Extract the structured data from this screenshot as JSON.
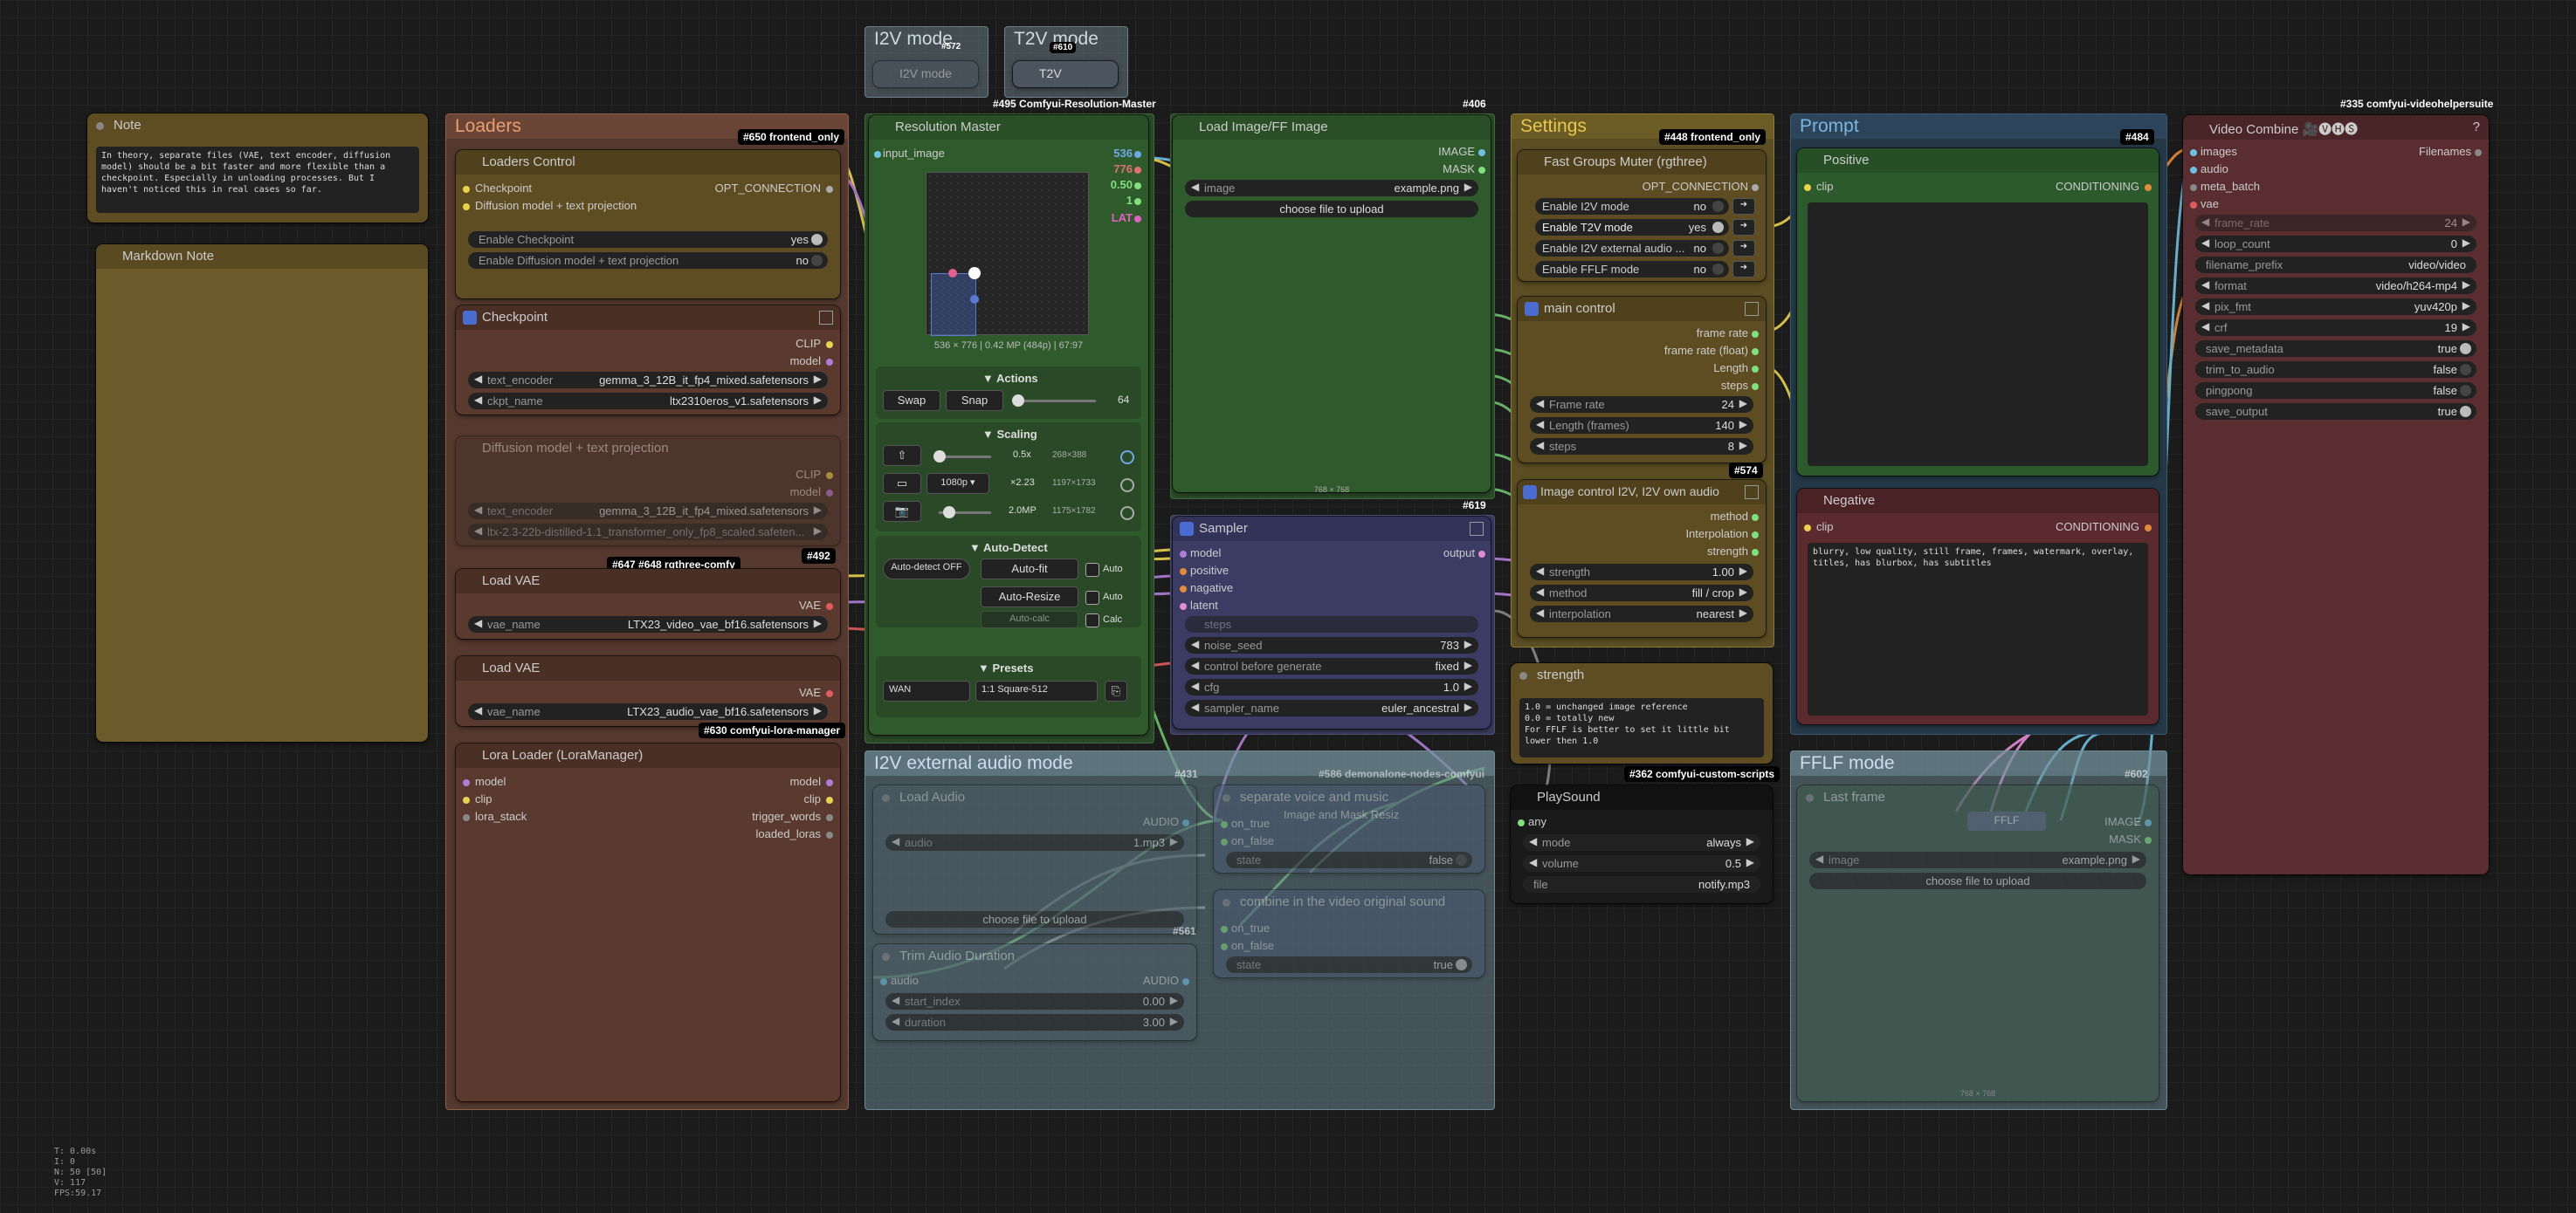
{
  "groups": {
    "i2v_mode_small": "I2V mode",
    "t2v_mode_small": "T2V mode",
    "loaders": "Loaders",
    "settings": "Settings",
    "prompt": "Prompt",
    "i2v_external_audio_mode": "I2V external audio mode",
    "fflf_mode": "FFLF mode"
  },
  "badges": {
    "b572": "#572",
    "b610": "#610",
    "b495": "#495 Comfyui-Resolution-Master",
    "b406": "#406",
    "b448": "#448 frontend_only",
    "b484": "#484",
    "b335": "#335 comfyui-videohelpersuite",
    "b650": "#650 frontend_only",
    "b492": "#492",
    "b647": "#647 #648 rgthree-comfy",
    "b630": "#630 comfyui-lora-manager",
    "b619": "#619",
    "b574": "#574",
    "b362": "#362 comfyui-custom-scripts",
    "b431": "#431",
    "b561": "#561",
    "b602": "#602",
    "b586": "#586 demonalone-nodes-comfyui"
  },
  "mini_nodes": {
    "i2v": "I2V mode",
    "t2v": "T2V"
  },
  "note": {
    "title": "Note",
    "text": "In theory, separate files (VAE, text encoder, diffusion model) should be a bit faster and more flexible than a checkpoint. Especially in unloading processes. But I haven't noticed this in real cases so far."
  },
  "markdown_note": {
    "title": "Markdown Note"
  },
  "loaders_control": {
    "title": "Loaders Control",
    "in1": "Checkpoint",
    "in2": "Diffusion model + text projection",
    "out": "OPT_CONNECTION",
    "w1_label": "Enable Checkpoint",
    "w1_value": "yes",
    "w2_label": "Enable Diffusion model + text projection",
    "w2_value": "no"
  },
  "checkpoint": {
    "title": "Checkpoint",
    "out1": "CLIP",
    "out2": "model",
    "text_encoder_label": "text_encoder",
    "text_encoder_value": "gemma_3_12B_it_fp4_mixed.safetensors",
    "ckpt_label": "ckpt_name",
    "ckpt_value": "ltx2310eros_v1.safetensors"
  },
  "diffusion_model": {
    "title": "Diffusion model + text projection",
    "out1": "CLIP",
    "out2": "model",
    "text_encoder_label": "text_encoder",
    "text_encoder_value": "gemma_3_12B_it_fp4_mixed.safetensors",
    "model_value": "ltx-2.3-22b-distilled-1.1_transformer_only_fp8_scaled.safeten..."
  },
  "load_vae_1": {
    "title": "Load VAE",
    "out": "VAE",
    "label": "vae_name",
    "value": "LTX23_video_vae_bf16.safetensors"
  },
  "load_vae_2": {
    "title": "Load VAE",
    "out": "VAE",
    "label": "vae_name",
    "value": "LTX23_audio_vae_bf16.safetensors"
  },
  "lora_loader": {
    "title": "Lora Loader (LoraManager)",
    "in1": "model",
    "in2": "clip",
    "in3": "lora_stack",
    "out1": "model",
    "out2": "clip",
    "out3": "trigger_words",
    "out4": "loaded_loras"
  },
  "resolution_master": {
    "title": "Resolution Master",
    "input": "input_image",
    "v1": "536",
    "v2": "776",
    "v3": "0.50",
    "v4": "1",
    "v5": "LAT",
    "info": "536 × 776  |  0.42 MP (484p)  |  67:97",
    "actions_h": "▼ Actions",
    "swap": "Swap",
    "snap": "Snap",
    "snap_val": "64",
    "scaling_h": "▼ Scaling",
    "s1_val": "0.5x",
    "s1_res": "268×388",
    "s2_sel": "1080p",
    "s2_val": "×2.23",
    "s2_res": "1197×1733",
    "s3_val": "2.0MP",
    "s3_res": "1175×1782",
    "autodetect_h": "▼ Auto-Detect",
    "autodetect_btn": "Auto-detect OFF",
    "autofit": "Auto-fit",
    "auto1": "Auto",
    "autoresize": "Auto-Resize",
    "auto2": "Auto",
    "autocalc": "Auto-calc",
    "calc": "Calc",
    "presets_h": "▼ Presets",
    "preset_cat": "WAN",
    "preset_val": "1:1 Square-512"
  },
  "load_image": {
    "title": "Load Image/FF Image",
    "out1": "IMAGE",
    "out2": "MASK",
    "img_label": "image",
    "img_value": "example.png",
    "upload": "choose file to upload",
    "dims": "768 × 768"
  },
  "sampler": {
    "title": "Sampler",
    "in1": "model",
    "in2": "positive",
    "in3": "nagative",
    "in4": "latent",
    "in5": "steps",
    "out": "output",
    "noise_label": "noise_seed",
    "noise_value": "783",
    "cbg_label": "control before generate",
    "cbg_value": "fixed",
    "cfg_label": "cfg",
    "cfg_value": "1.0",
    "sampler_label": "sampler_name",
    "sampler_value": "euler_ancestral"
  },
  "fast_groups": {
    "title": "Fast Groups Muter (rgthree)",
    "out": "OPT_CONNECTION",
    "r1": "Enable I2V mode",
    "r1v": "no",
    "r2": "Enable T2V mode",
    "r2v": "yes",
    "r3": "Enable I2V external audio ...",
    "r3v": "no",
    "r4": "Enable FFLF mode",
    "r4v": "no"
  },
  "main_control": {
    "title": "main control",
    "o1": "frame rate",
    "o2": "frame rate (float)",
    "o3": "Length",
    "o4": "steps",
    "w1": "Frame rate",
    "w1v": "24",
    "w2": "Length (frames)",
    "w2v": "140",
    "w3": "steps",
    "w3v": "8"
  },
  "image_control": {
    "title": "Image control I2V, I2V own audio",
    "o1": "method",
    "o2": "Interpolation",
    "o3": "strength",
    "w1": "strength",
    "w1v": "1.00",
    "w2": "method",
    "w2v": "fill / crop",
    "w3": "interpolation",
    "w3v": "nearest"
  },
  "strength_note": {
    "title": "strength",
    "text": "1.0 = unchanged image reference\n0.0 = totally new\nFor FFLF is better to set it little bit lower then 1.0"
  },
  "playsound": {
    "title": "PlaySound",
    "in": "any",
    "mode": "mode",
    "mode_v": "always",
    "volume": "volume",
    "volume_v": "0.5",
    "file": "file",
    "file_v": "notify.mp3"
  },
  "positive": {
    "title": "Positive",
    "in": "clip",
    "out": "CONDITIONING"
  },
  "negative": {
    "title": "Negative",
    "in": "clip",
    "out": "CONDITIONING",
    "text": "blurry, low quality, still frame, frames, watermark, overlay, titles, has blurbox, has subtitles"
  },
  "video_combine": {
    "title": "Video Combine 🎥🅥🅗🅢",
    "in1": "images",
    "in2": "audio",
    "in3": "meta_batch",
    "in4": "vae",
    "out": "Filenames",
    "rows": [
      {
        "l": "frame_rate",
        "v": "24"
      },
      {
        "l": "loop_count",
        "v": "0"
      },
      {
        "l": "filename_prefix",
        "v": "video/video"
      },
      {
        "l": "format",
        "v": "video/h264-mp4"
      },
      {
        "l": "pix_fmt",
        "v": "yuv420p"
      },
      {
        "l": "crf",
        "v": "19"
      },
      {
        "l": "save_metadata",
        "v": "true"
      },
      {
        "l": "trim_to_audio",
        "v": "false"
      },
      {
        "l": "pingpong",
        "v": "false"
      },
      {
        "l": "save_output",
        "v": "true"
      }
    ]
  },
  "load_audio": {
    "title": "Load Audio",
    "out": "AUDIO",
    "label": "audio",
    "value": "1.mp3",
    "upload": "choose file to upload"
  },
  "trim_audio": {
    "title": "Trim Audio Duration",
    "in": "audio",
    "out": "AUDIO",
    "w1": "start_index",
    "w1v": "0.00",
    "w2": "duration",
    "w2v": "3.00"
  },
  "separate_voice": {
    "title": "separate voice and music",
    "in1": "on_true",
    "in2": "on_false",
    "w": "state",
    "wv": "false",
    "sub": "Image and Mask Resiz"
  },
  "combine_video": {
    "title": "combine in the video original sound",
    "in1": "on_true",
    "in2": "on_false",
    "w": "state",
    "wv": "true"
  },
  "fflf": {
    "title": "Last frame",
    "out1": "IMAGE",
    "out2": "MASK",
    "img_label": "image",
    "img_value": "example.png",
    "upload": "choose file to upload",
    "dims": "768 × 768",
    "fflf_label": "FFLF"
  },
  "hud": [
    "T: 0.00s",
    "I: 0",
    "N: 50 [50]",
    "V: 117",
    "FPS:59.17"
  ]
}
